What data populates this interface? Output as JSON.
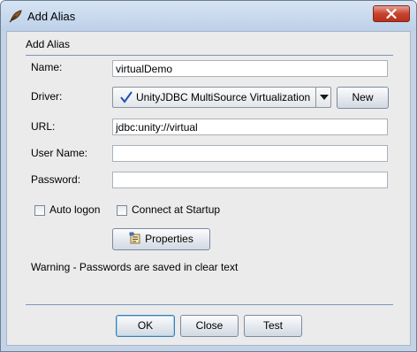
{
  "window": {
    "title": "Add Alias",
    "close_icon": "close-icon",
    "app_icon": "feather-icon"
  },
  "form": {
    "group_title": "Add Alias",
    "name": {
      "label": "Name:",
      "value": "virtualDemo"
    },
    "driver": {
      "label": "Driver:",
      "selected": "UnityJDBC MultiSource Virtualization",
      "check_icon": "checkmark-icon",
      "new_label": "New"
    },
    "url": {
      "label": "URL:",
      "value": "jdbc:unity://virtual"
    },
    "user_name": {
      "label": "User Name:",
      "value": ""
    },
    "password": {
      "label": "Password:",
      "value": ""
    },
    "auto_logon": {
      "label": "Auto logon",
      "checked": false
    },
    "connect_at_startup": {
      "label": "Connect at Startup",
      "checked": false
    },
    "properties_label": "Properties",
    "warning": "Warning - Passwords are saved in clear text"
  },
  "footer": {
    "ok_label": "OK",
    "close_label": "Close",
    "test_label": "Test"
  },
  "colors": {
    "title_gradient_top": "#d6e4f3",
    "close_red": "#c7442f",
    "panel": "#ebebeb",
    "check_blue": "#1f4fb3"
  }
}
